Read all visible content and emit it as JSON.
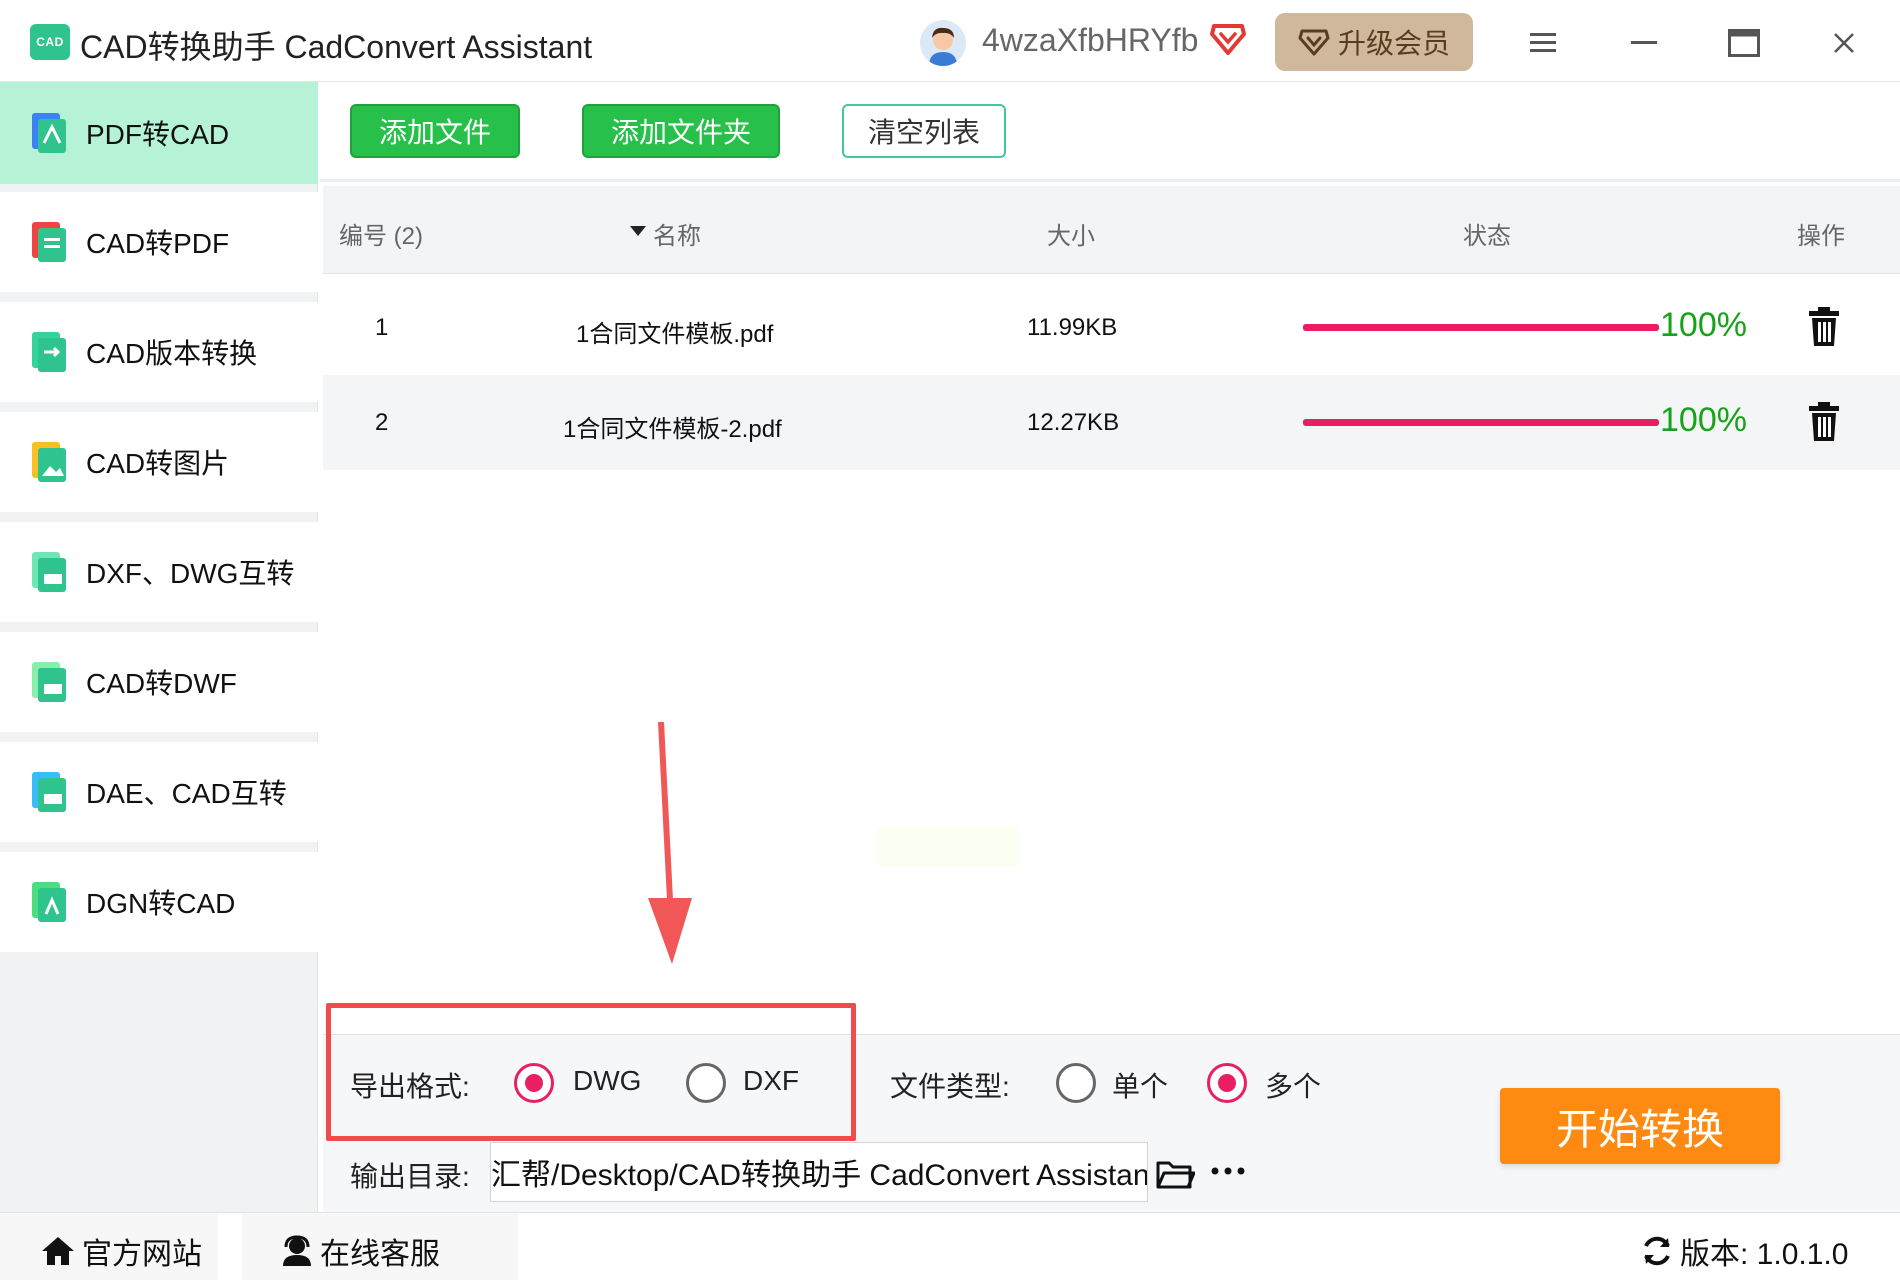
{
  "titlebar": {
    "logo_text": "CAD",
    "title": "CAD转换助手 CadConvert Assistant",
    "username": "4wzaXfbHRYfb",
    "upgrade_label": "升级会员"
  },
  "sidebar": {
    "items": [
      {
        "label": "PDF转CAD",
        "icon": "pdf-to-cad-icon",
        "active": true
      },
      {
        "label": "CAD转PDF",
        "icon": "cad-to-pdf-icon"
      },
      {
        "label": "CAD版本转换",
        "icon": "cad-version-icon"
      },
      {
        "label": "CAD转图片",
        "icon": "cad-to-image-icon"
      },
      {
        "label": "DXF、DWG互转",
        "icon": "dxf-dwg-icon"
      },
      {
        "label": "CAD转DWF",
        "icon": "cad-to-dwf-icon"
      },
      {
        "label": "DAE、CAD互转",
        "icon": "dae-cad-icon"
      },
      {
        "label": "DGN转CAD",
        "icon": "dgn-to-cad-icon"
      }
    ]
  },
  "toolbar": {
    "add_file": "添加文件",
    "add_folder": "添加文件夹",
    "clear_list": "清空列表"
  },
  "table": {
    "headers": {
      "index": "编号 (2)",
      "name": "名称",
      "size": "大小",
      "status": "状态",
      "action": "操作"
    },
    "rows": [
      {
        "index": "1",
        "name": "1合同文件模板.pdf",
        "size": "11.99KB",
        "progress": 100,
        "progress_text": "100%"
      },
      {
        "index": "2",
        "name": "1合同文件模板-2.pdf",
        "size": "12.27KB",
        "progress": 100,
        "progress_text": "100%"
      }
    ]
  },
  "options": {
    "export_format_label": "导出格式:",
    "formats": [
      {
        "label": "DWG",
        "selected": true
      },
      {
        "label": "DXF",
        "selected": false
      }
    ],
    "file_type_label": "文件类型:",
    "file_types": [
      {
        "label": "单个",
        "selected": false
      },
      {
        "label": "多个",
        "selected": true
      }
    ],
    "output_dir_label": "输出目录:",
    "output_dir": "汇帮/Desktop/CAD转换助手 CadConvert Assistant",
    "start_button": "开始转换"
  },
  "footer": {
    "website": "官方网站",
    "support": "在线客服",
    "version": "版本: 1.0.1.0"
  },
  "colors": {
    "accent_green": "#27c04a",
    "active_tab": "#b6f2d6",
    "progress": "#e91e63",
    "percent_text": "#17a317",
    "start_button": "#ff8a12",
    "highlight": "#f24b4b"
  }
}
